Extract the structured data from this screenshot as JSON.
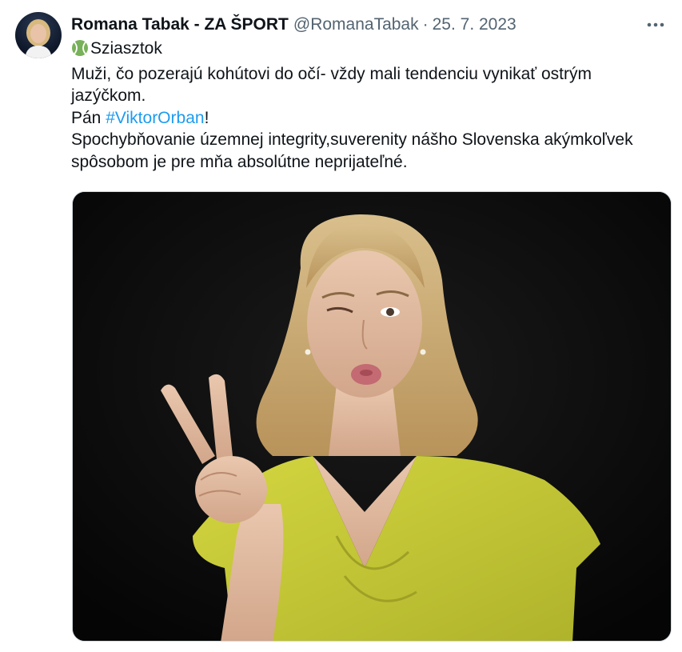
{
  "tweet": {
    "author_name": "Romana Tabak - ZA ŠPORT",
    "handle": "@RomanaTabak",
    "separator": "·",
    "date": "25. 7. 2023",
    "lines": [
      "Sziasztok",
      "Muži, čo pozerajú kohútovi do očí- vždy mali tendenciu vynikať ostrým",
      "jazýčkom.",
      "Pán ",
      "!",
      "Spochybňovanie územnej integrity,suverenity nášho Slovenska akýmkoľvek",
      "spôsobom je pre mňa absolútne neprijateľné."
    ],
    "hashtag": "#ViktorOrban",
    "emoji_icon": "tennis-ball-icon",
    "more_icon": "more-horizontal-icon"
  },
  "colors": {
    "text": "#0f1419",
    "secondary": "#536471",
    "link": "#1d9bf0",
    "dress": "#c9cd3a",
    "photo_bg": "#0a0a0a"
  }
}
